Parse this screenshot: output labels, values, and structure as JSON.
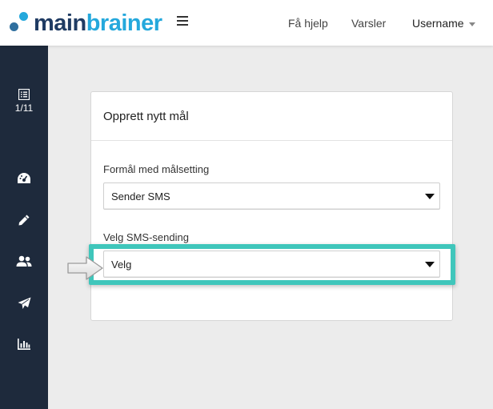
{
  "header": {
    "logo_main": "main",
    "logo_brainer": "brainer",
    "help_label": "Få hjelp",
    "notifications_label": "Varsler",
    "user_label": "Username"
  },
  "sidebar": {
    "step_counter": "1/11",
    "items": [
      {
        "icon": "dashboard-icon"
      },
      {
        "icon": "pencil-icon"
      },
      {
        "icon": "users-icon"
      },
      {
        "icon": "paper-plane-icon"
      },
      {
        "icon": "bar-chart-icon"
      }
    ]
  },
  "card": {
    "title": "Opprett nytt mål",
    "purpose_label": "Formål med målsetting",
    "purpose_value": "Sender SMS",
    "sms_label": "Velg SMS-sending",
    "sms_value": "Velg"
  },
  "colors": {
    "sidebar_bg": "#1e2a3c",
    "highlight": "#3fc6bb",
    "logo_dark": "#1f3b63",
    "logo_light": "#24a8dc"
  }
}
